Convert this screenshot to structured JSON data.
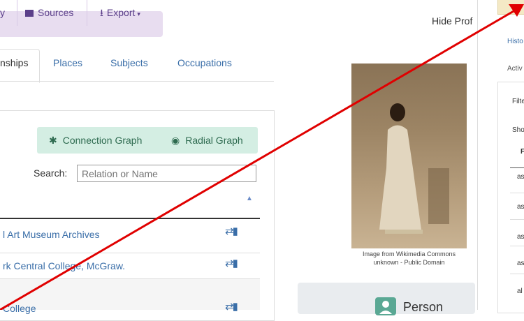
{
  "toolbar": {
    "partial_label": "y",
    "sources_label": "Sources",
    "export_label": "Export",
    "hide_profile_label": "Hide Prof"
  },
  "tabs": {
    "relationships_label": "nships",
    "places_label": "Places",
    "subjects_label": "Subjects",
    "occupations_label": "Occupations"
  },
  "graph": {
    "connection_label": "Connection Graph",
    "radial_label": "Radial Graph"
  },
  "search": {
    "label": "Search:",
    "placeholder": "Relation or Name"
  },
  "relations": [
    {
      "name": "l Art Museum Archives"
    },
    {
      "name": "rk Central College, McGraw."
    },
    {
      "name": "College"
    }
  ],
  "image": {
    "caption_line1": "Image from Wikimedia Commons",
    "caption_line2": "unknown - Public Domain"
  },
  "person": {
    "label": "Person"
  },
  "right_panel": {
    "hist_label": "Histo",
    "activ_label": "Activ",
    "filter_label": "Filte",
    "show_label": "Sho",
    "header_label": "F",
    "rows": [
      "as",
      "as",
      "as",
      "as",
      "al"
    ]
  },
  "colors": {
    "accent_link": "#3a6ea8",
    "toolbar_bg": "#e8ddf0",
    "graph_bg": "#d4eee3",
    "arrow": "#e00000"
  }
}
